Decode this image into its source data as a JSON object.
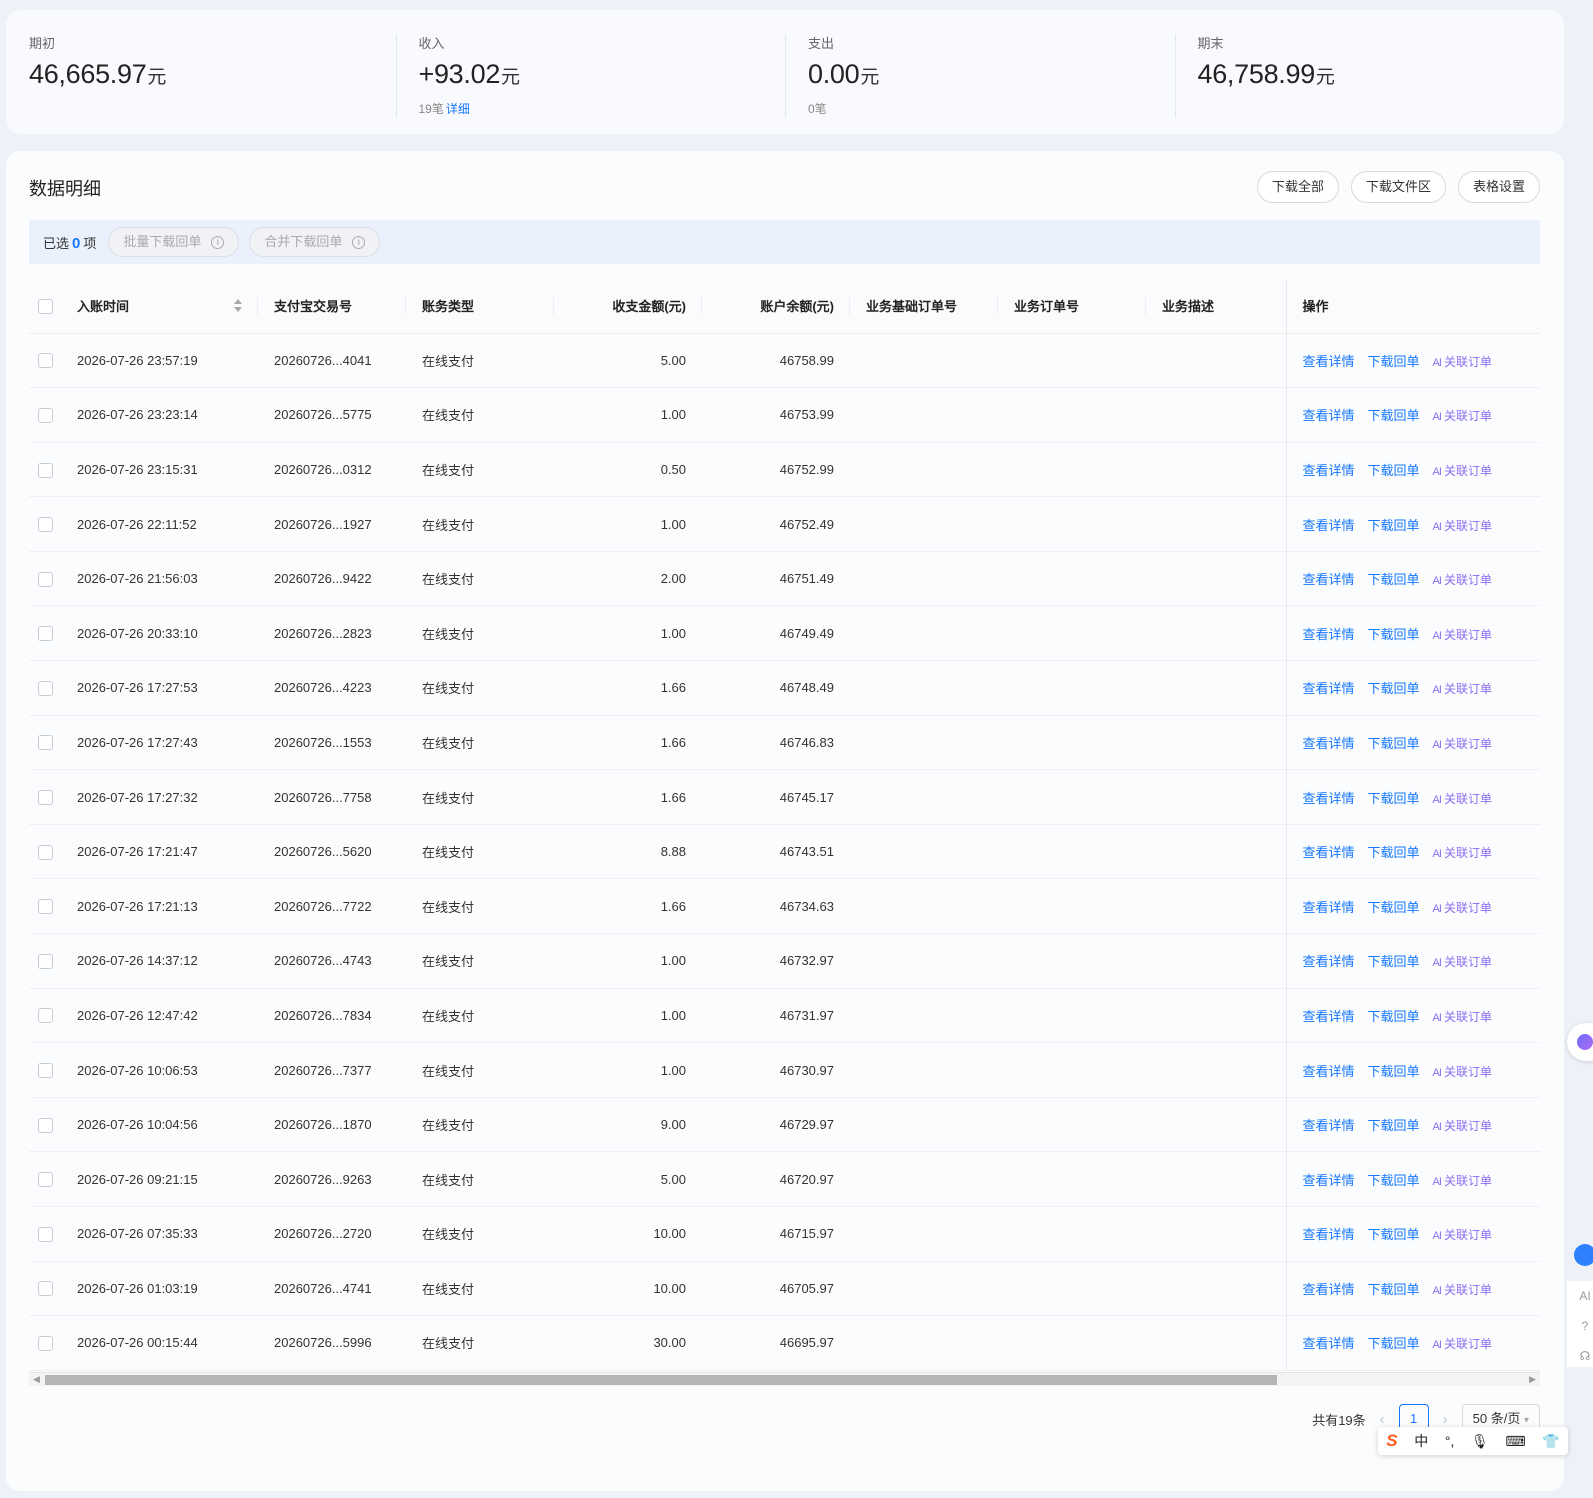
{
  "summary": {
    "opening": {
      "label": "期初",
      "value": "46,665.97",
      "unit": "元"
    },
    "income": {
      "label": "收入",
      "value": "+93.02",
      "unit": "元",
      "count": "19笔",
      "detail_link": "详细"
    },
    "expense": {
      "label": "支出",
      "value": "0.00",
      "unit": "元",
      "count": "0笔"
    },
    "closing": {
      "label": "期末",
      "value": "46,758.99",
      "unit": "元"
    }
  },
  "section": {
    "title": "数据明细",
    "buttons": {
      "download_all": "下载全部",
      "download_files": "下载文件区",
      "table_settings": "表格设置"
    }
  },
  "selection": {
    "prefix": "已选",
    "count": "0",
    "suffix": "项",
    "batch_download": "批量下载回单",
    "merge_download": "合并下载回单"
  },
  "table": {
    "headers": {
      "time": "入账时间",
      "trade_no": "支付宝交易号",
      "type": "账务类型",
      "amount": "收支金额(元)",
      "balance": "账户余额(元)",
      "base_order": "业务基础订单号",
      "order": "业务订单号",
      "desc": "业务描述",
      "ops": "操作"
    },
    "ops": {
      "view": "查看详情",
      "download": "下载回单",
      "link_mark": "AI",
      "link": "关联订单"
    },
    "rows": [
      {
        "time": "2026-07-26 23:57:19",
        "trade_no": "20260726...4041",
        "type": "在线支付",
        "amount": "5.00",
        "balance": "46758.99"
      },
      {
        "time": "2026-07-26 23:23:14",
        "trade_no": "20260726...5775",
        "type": "在线支付",
        "amount": "1.00",
        "balance": "46753.99"
      },
      {
        "time": "2026-07-26 23:15:31",
        "trade_no": "20260726...0312",
        "type": "在线支付",
        "amount": "0.50",
        "balance": "46752.99"
      },
      {
        "time": "2026-07-26 22:11:52",
        "trade_no": "20260726...1927",
        "type": "在线支付",
        "amount": "1.00",
        "balance": "46752.49"
      },
      {
        "time": "2026-07-26 21:56:03",
        "trade_no": "20260726...9422",
        "type": "在线支付",
        "amount": "2.00",
        "balance": "46751.49"
      },
      {
        "time": "2026-07-26 20:33:10",
        "trade_no": "20260726...2823",
        "type": "在线支付",
        "amount": "1.00",
        "balance": "46749.49"
      },
      {
        "time": "2026-07-26 17:27:53",
        "trade_no": "20260726...4223",
        "type": "在线支付",
        "amount": "1.66",
        "balance": "46748.49"
      },
      {
        "time": "2026-07-26 17:27:43",
        "trade_no": "20260726...1553",
        "type": "在线支付",
        "amount": "1.66",
        "balance": "46746.83"
      },
      {
        "time": "2026-07-26 17:27:32",
        "trade_no": "20260726...7758",
        "type": "在线支付",
        "amount": "1.66",
        "balance": "46745.17"
      },
      {
        "time": "2026-07-26 17:21:47",
        "trade_no": "20260726...5620",
        "type": "在线支付",
        "amount": "8.88",
        "balance": "46743.51"
      },
      {
        "time": "2026-07-26 17:21:13",
        "trade_no": "20260726...7722",
        "type": "在线支付",
        "amount": "1.66",
        "balance": "46734.63"
      },
      {
        "time": "2026-07-26 14:37:12",
        "trade_no": "20260726...4743",
        "type": "在线支付",
        "amount": "1.00",
        "balance": "46732.97"
      },
      {
        "time": "2026-07-26 12:47:42",
        "trade_no": "20260726...7834",
        "type": "在线支付",
        "amount": "1.00",
        "balance": "46731.97"
      },
      {
        "time": "2026-07-26 10:06:53",
        "trade_no": "20260726...7377",
        "type": "在线支付",
        "amount": "1.00",
        "balance": "46730.97"
      },
      {
        "time": "2026-07-26 10:04:56",
        "trade_no": "20260726...1870",
        "type": "在线支付",
        "amount": "9.00",
        "balance": "46729.97"
      },
      {
        "time": "2026-07-26 09:21:15",
        "trade_no": "20260726...9263",
        "type": "在线支付",
        "amount": "5.00",
        "balance": "46720.97"
      },
      {
        "time": "2026-07-26 07:35:33",
        "trade_no": "20260726...2720",
        "type": "在线支付",
        "amount": "10.00",
        "balance": "46715.97"
      },
      {
        "time": "2026-07-26 01:03:19",
        "trade_no": "20260726...4741",
        "type": "在线支付",
        "amount": "10.00",
        "balance": "46705.97"
      },
      {
        "time": "2026-07-26 00:15:44",
        "trade_no": "20260726...5996",
        "type": "在线支付",
        "amount": "30.00",
        "balance": "46695.97"
      }
    ]
  },
  "pagination": {
    "total": "共有19条",
    "current": "1",
    "page_size": "50 条/页"
  },
  "side": {
    "ai_label": "AI",
    "help": "?",
    "headset": "☊"
  },
  "ime": {
    "logo": "S",
    "lang": "中",
    "punct": "°,",
    "mic": "🎙",
    "keyboard": "⌨",
    "shirt": "👕"
  },
  "colors": {
    "accent": "#1677ff",
    "ai": "#8b6cf0"
  }
}
